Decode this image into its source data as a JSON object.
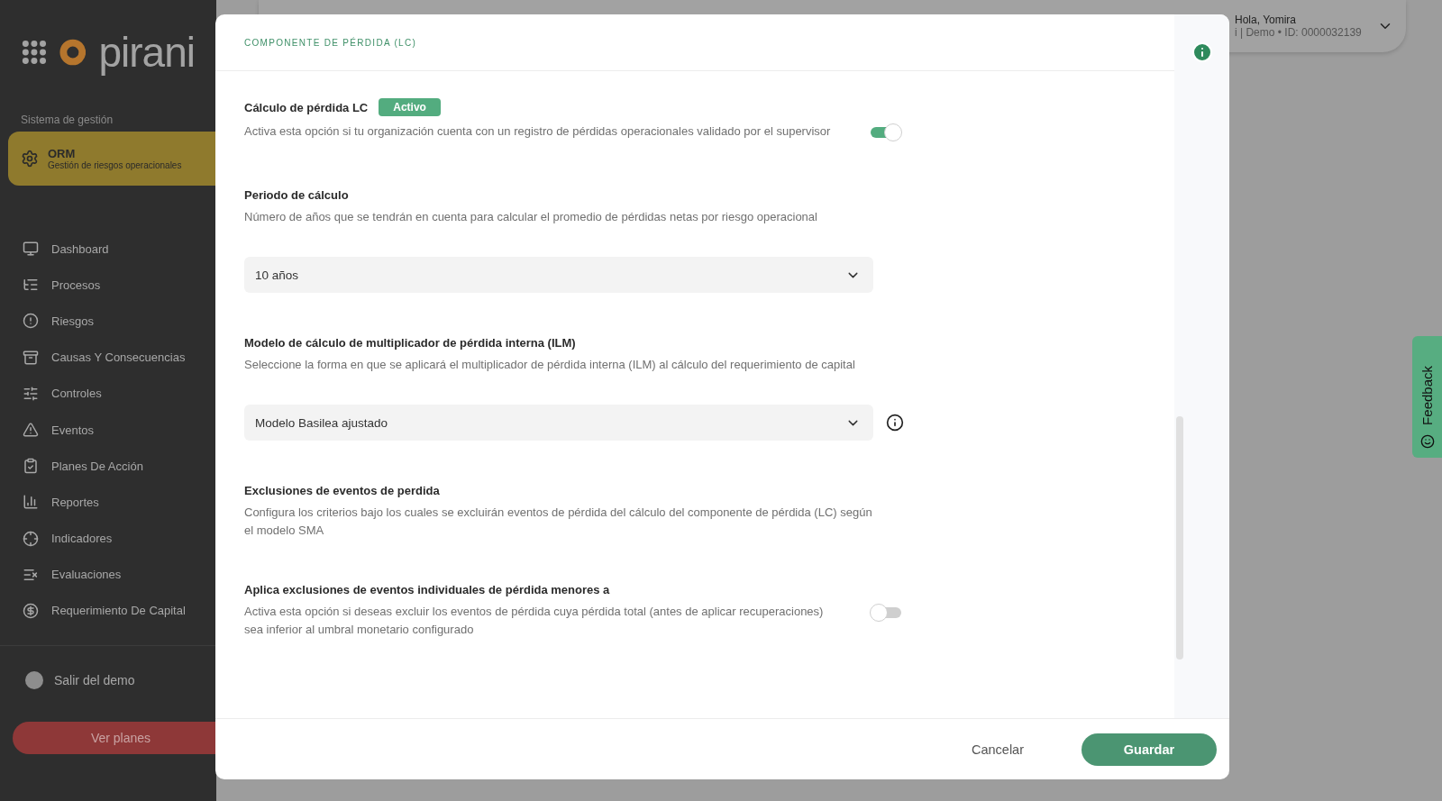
{
  "sidebar": {
    "logo_text": "pirani",
    "section_label": "Sistema de gestión",
    "module": {
      "title": "ORM",
      "subtitle": "Gestión de riesgos operacionales"
    },
    "items": [
      {
        "label": "Dashboard"
      },
      {
        "label": "Procesos"
      },
      {
        "label": "Riesgos"
      },
      {
        "label": "Causas Y Consecuencias"
      },
      {
        "label": "Controles"
      },
      {
        "label": "Eventos"
      },
      {
        "label": "Planes De Acción"
      },
      {
        "label": "Reportes"
      },
      {
        "label": "Indicadores"
      },
      {
        "label": "Evaluaciones"
      },
      {
        "label": "Requerimiento De Capital"
      }
    ],
    "exit": "Salir del demo",
    "plans_button": "Ver planes"
  },
  "topbar": {
    "greeting": "Hola, Yomira",
    "account": "i | Demo • ID: 0000032139"
  },
  "modal": {
    "title": "COMPONENTE DE PÉRDIDA (LC)",
    "settings": [
      {
        "kind": "toggle",
        "title": "Cálculo de pérdida LC",
        "badge": "Activo",
        "description": "Activa esta opción si tu organización cuenta con un registro de pérdidas operacionales validado por el supervisor",
        "on": true
      },
      {
        "kind": "select",
        "title": "Periodo de cálculo",
        "description": "Número de años que se tendrán en cuenta para calcular el promedio de pérdidas netas por riesgo operacional",
        "value": "10 años",
        "info": false
      },
      {
        "kind": "select",
        "title": "Modelo de cálculo de multiplicador de pérdida interna (ILM)",
        "description": "Seleccione la forma en que se aplicará el multiplicador de pérdida interna (ILM) al cálculo del requerimiento de capital",
        "value": "Modelo Basilea ajustado",
        "info": true
      },
      {
        "kind": "heading",
        "title": "Exclusiones de eventos de perdida",
        "description": "Configura los criterios bajo los cuales se excluirán eventos de pérdida del cálculo del componente de pérdida (LC) según el modelo SMA"
      },
      {
        "kind": "toggle",
        "title": "Aplica exclusiones de eventos individuales de pérdida menores a",
        "description": "Activa esta opción si deseas excluir los eventos de pérdida cuya pérdida total (antes de aplicar recuperaciones) sea inferior al umbral monetario configurado",
        "on": false
      }
    ],
    "cancel": "Cancelar",
    "save": "Guardar"
  },
  "feedback": "Feedback"
}
